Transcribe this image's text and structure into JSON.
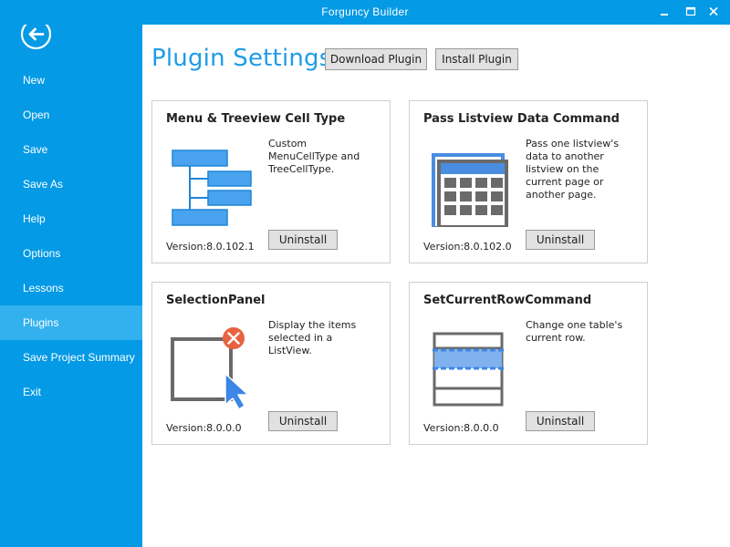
{
  "window": {
    "title": "Forguncy Builder",
    "accent_color": "#049ae5",
    "sidebar_active_color": "#33b1ee"
  },
  "sidebar": {
    "back_icon": "back-arrow-icon",
    "items": [
      {
        "label": "New"
      },
      {
        "label": "Open"
      },
      {
        "label": "Save"
      },
      {
        "label": "Save As"
      },
      {
        "label": "Help"
      },
      {
        "label": "Options"
      },
      {
        "label": "Lessons"
      },
      {
        "label": "Plugins",
        "active": true
      },
      {
        "label": "Save Project Summary"
      },
      {
        "label": "Exit"
      }
    ]
  },
  "main": {
    "page_title": "Plugin Settings",
    "download_label": "Download Plugin",
    "install_label": "Install Plugin",
    "cards": [
      {
        "title": "Menu & Treeview Cell Type",
        "desc_lines": [
          "Custom",
          "MenuCellType and",
          "TreeCellType."
        ],
        "version": "Version:8.0.102.1",
        "uninstall_label": "Uninstall",
        "icon": "menu-tree-icon"
      },
      {
        "title": "Pass Listview Data Command",
        "desc_lines": [
          "Pass one listview's",
          "data to another",
          "listview on the",
          "current page or",
          "another page."
        ],
        "version": "Version:8.0.102.0",
        "uninstall_label": "Uninstall",
        "icon": "listview-grid-icon"
      },
      {
        "title": "SelectionPanel",
        "desc_lines": [
          "Display the items",
          "selected in a",
          "ListView."
        ],
        "version": "Version:8.0.0.0",
        "uninstall_label": "Uninstall",
        "icon": "selection-panel-icon"
      },
      {
        "title": "SetCurrentRowCommand",
        "desc_lines": [
          "Change one table's",
          "current row."
        ],
        "version": "Version:8.0.0.0",
        "uninstall_label": "Uninstall",
        "icon": "current-row-icon"
      }
    ]
  }
}
